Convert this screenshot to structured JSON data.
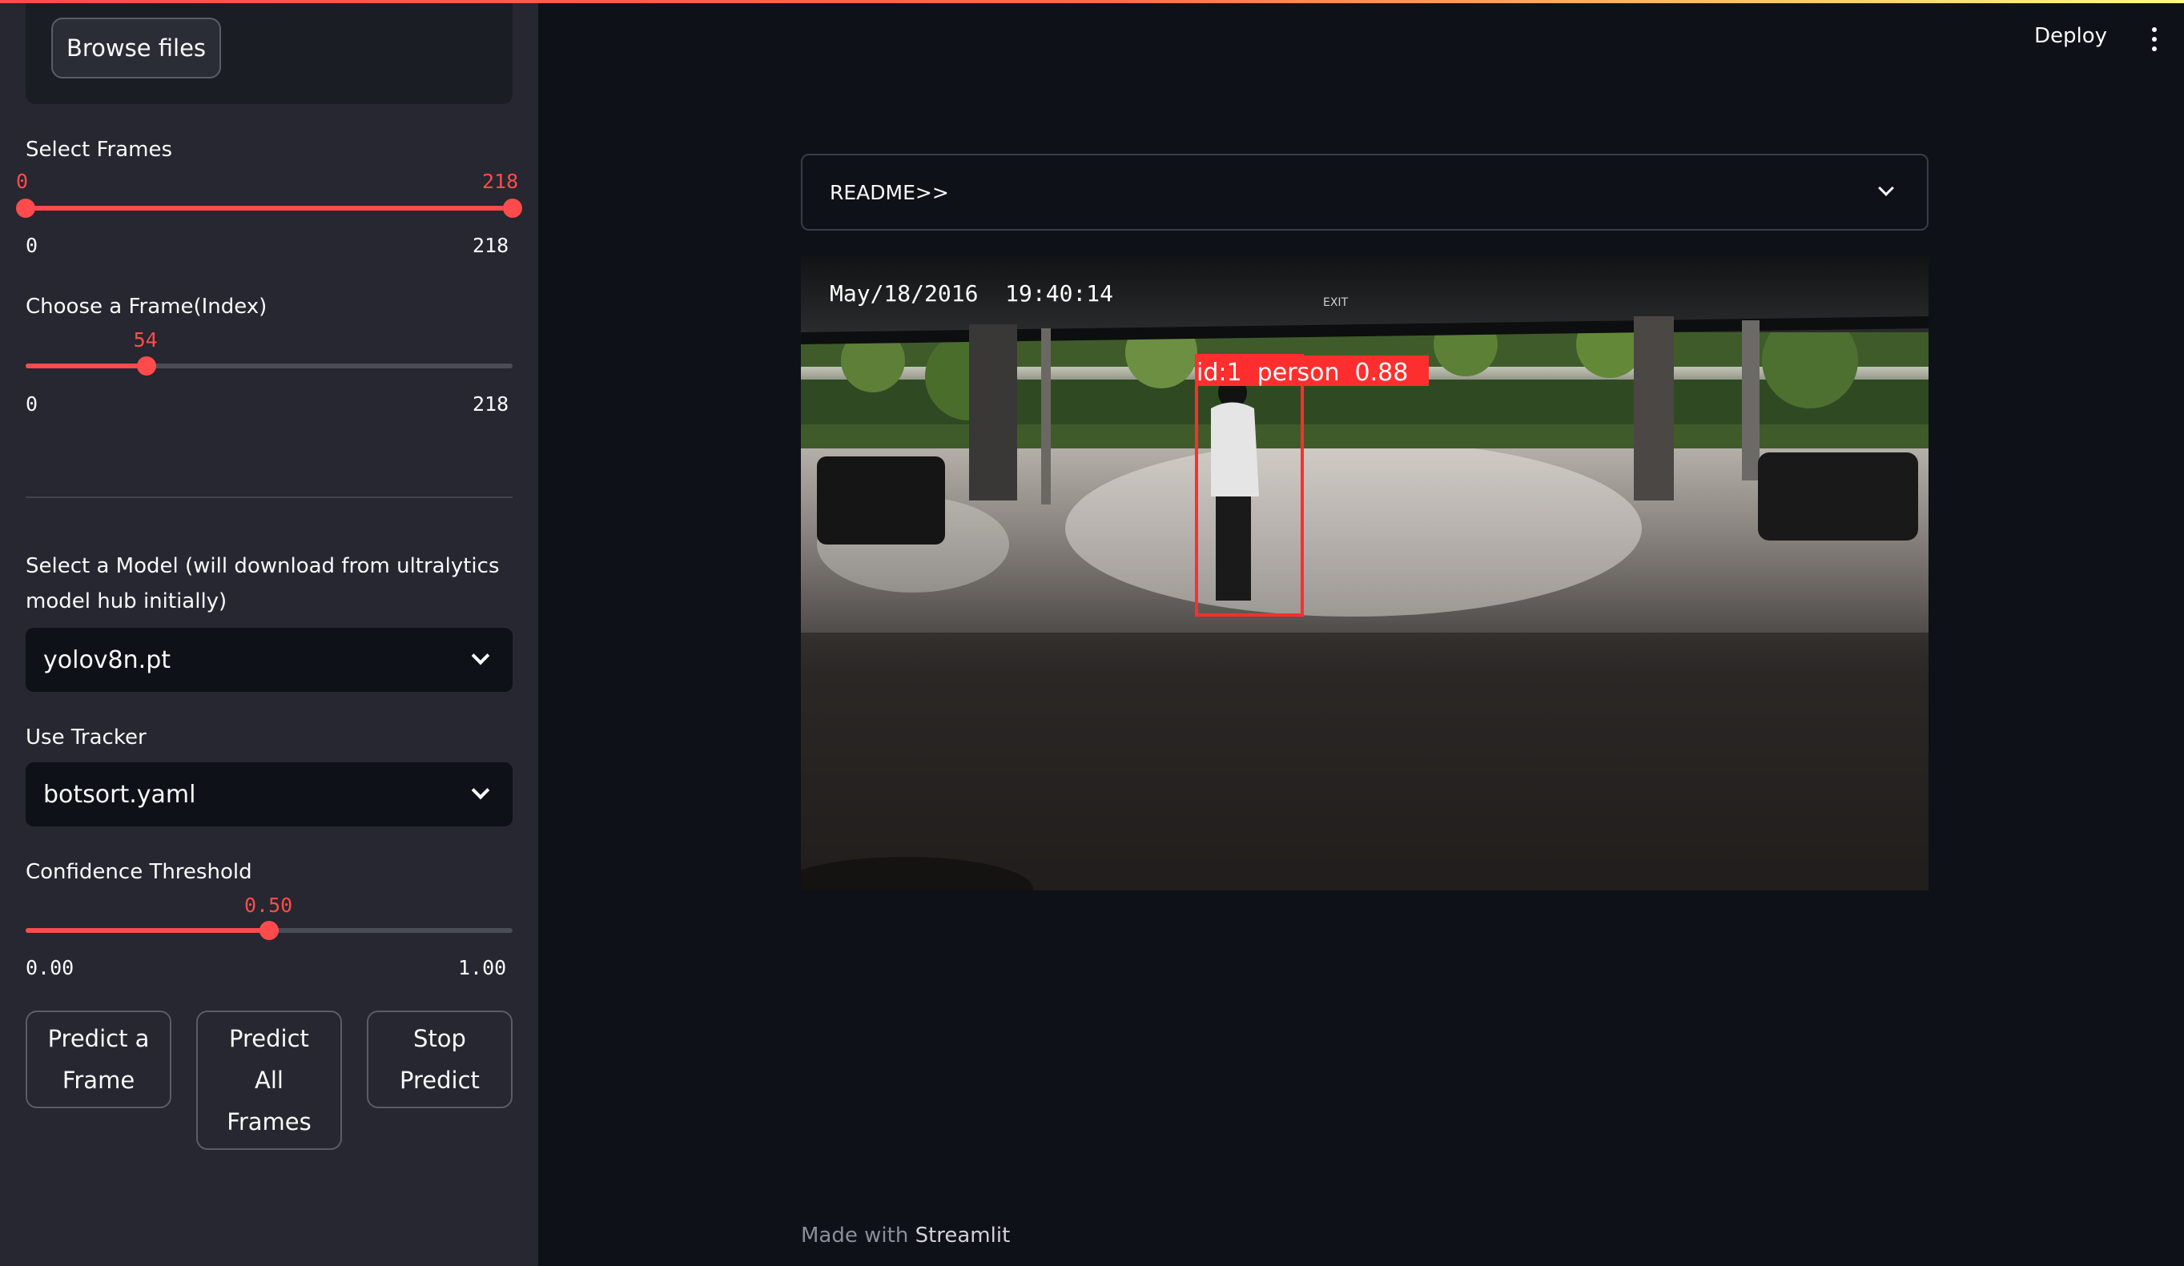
{
  "sidebar": {
    "browse_label": "Browse files",
    "select_frames": {
      "label": "Select Frames",
      "low_value": "0",
      "high_value": "218",
      "min": "0",
      "max": "218",
      "low_fraction": 0,
      "high_fraction": 1
    },
    "choose_frame": {
      "label": "Choose a Frame(Index)",
      "value": "54",
      "min": "0",
      "max": "218",
      "fraction": 0.2477
    },
    "model": {
      "label_line1": "Select a Model (will download from ultralytics",
      "label_line2": "model hub initially)",
      "selected": "yolov8n.pt"
    },
    "tracker": {
      "label": "Use Tracker",
      "selected": "botsort.yaml"
    },
    "confidence": {
      "label": "Confidence Threshold",
      "value": "0.50",
      "min": "0.00",
      "max": "1.00",
      "fraction": 0.5
    },
    "buttons": {
      "predict_frame": [
        "Predict a",
        "Frame"
      ],
      "predict_all": [
        "Predict",
        "All",
        "Frames"
      ],
      "stop_predict": [
        "Stop",
        "Predict"
      ]
    }
  },
  "header": {
    "deploy_label": "Deploy"
  },
  "main": {
    "expander_label": "README>>",
    "video": {
      "timestamp": "May/18/2016  19:40:14",
      "exit_sign": "EXIT",
      "detection_label": "id:1  person  0.88"
    },
    "footer_prefix": "Made with",
    "footer_brand": "Streamlit"
  },
  "colors": {
    "accent": "#ff4b4b",
    "background": "#0e1117",
    "sidebar": "#262730"
  }
}
